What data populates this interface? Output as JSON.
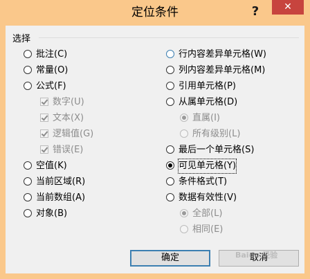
{
  "window": {
    "title": "定位条件",
    "help_label": "?",
    "close_label": "✕"
  },
  "group": {
    "label": "选择"
  },
  "left_options": [
    {
      "label": "批注(C)",
      "checked": false
    },
    {
      "label": "常量(O)",
      "checked": false
    },
    {
      "label": "公式(F)",
      "checked": false
    },
    {
      "label": "空值(K)",
      "checked": false
    },
    {
      "label": "当前区域(R)",
      "checked": false
    },
    {
      "label": "当前数组(A)",
      "checked": false
    },
    {
      "label": "对象(B)",
      "checked": false
    }
  ],
  "formula_checks": [
    {
      "label": "数字(U)",
      "checked": true
    },
    {
      "label": "文本(X)",
      "checked": true
    },
    {
      "label": "逻辑值(G)",
      "checked": true
    },
    {
      "label": "错误(E)",
      "checked": true
    }
  ],
  "right_options": [
    {
      "label": "行内容差异单元格(W)",
      "checked": false
    },
    {
      "label": "列内容差异单元格(M)",
      "checked": false
    },
    {
      "label": "引用单元格(P)",
      "checked": false
    },
    {
      "label": "从属单元格(D)",
      "checked": false
    },
    {
      "label": "最后一个单元格(S)",
      "checked": false
    },
    {
      "label": "可见单元格(Y)",
      "checked": true
    },
    {
      "label": "条件格式(T)",
      "checked": false
    },
    {
      "label": "数据有效性(V)",
      "checked": false
    }
  ],
  "dependents_sub": [
    {
      "label": "直属(I)",
      "checked": true
    },
    {
      "label": "所有级别(L)",
      "checked": false
    }
  ],
  "validation_sub": [
    {
      "label": "全部(L)",
      "checked": true
    },
    {
      "label": "相同(E)",
      "checked": false
    }
  ],
  "buttons": {
    "ok": "确定",
    "cancel": "取消"
  },
  "watermark": "Baidu 经验"
}
